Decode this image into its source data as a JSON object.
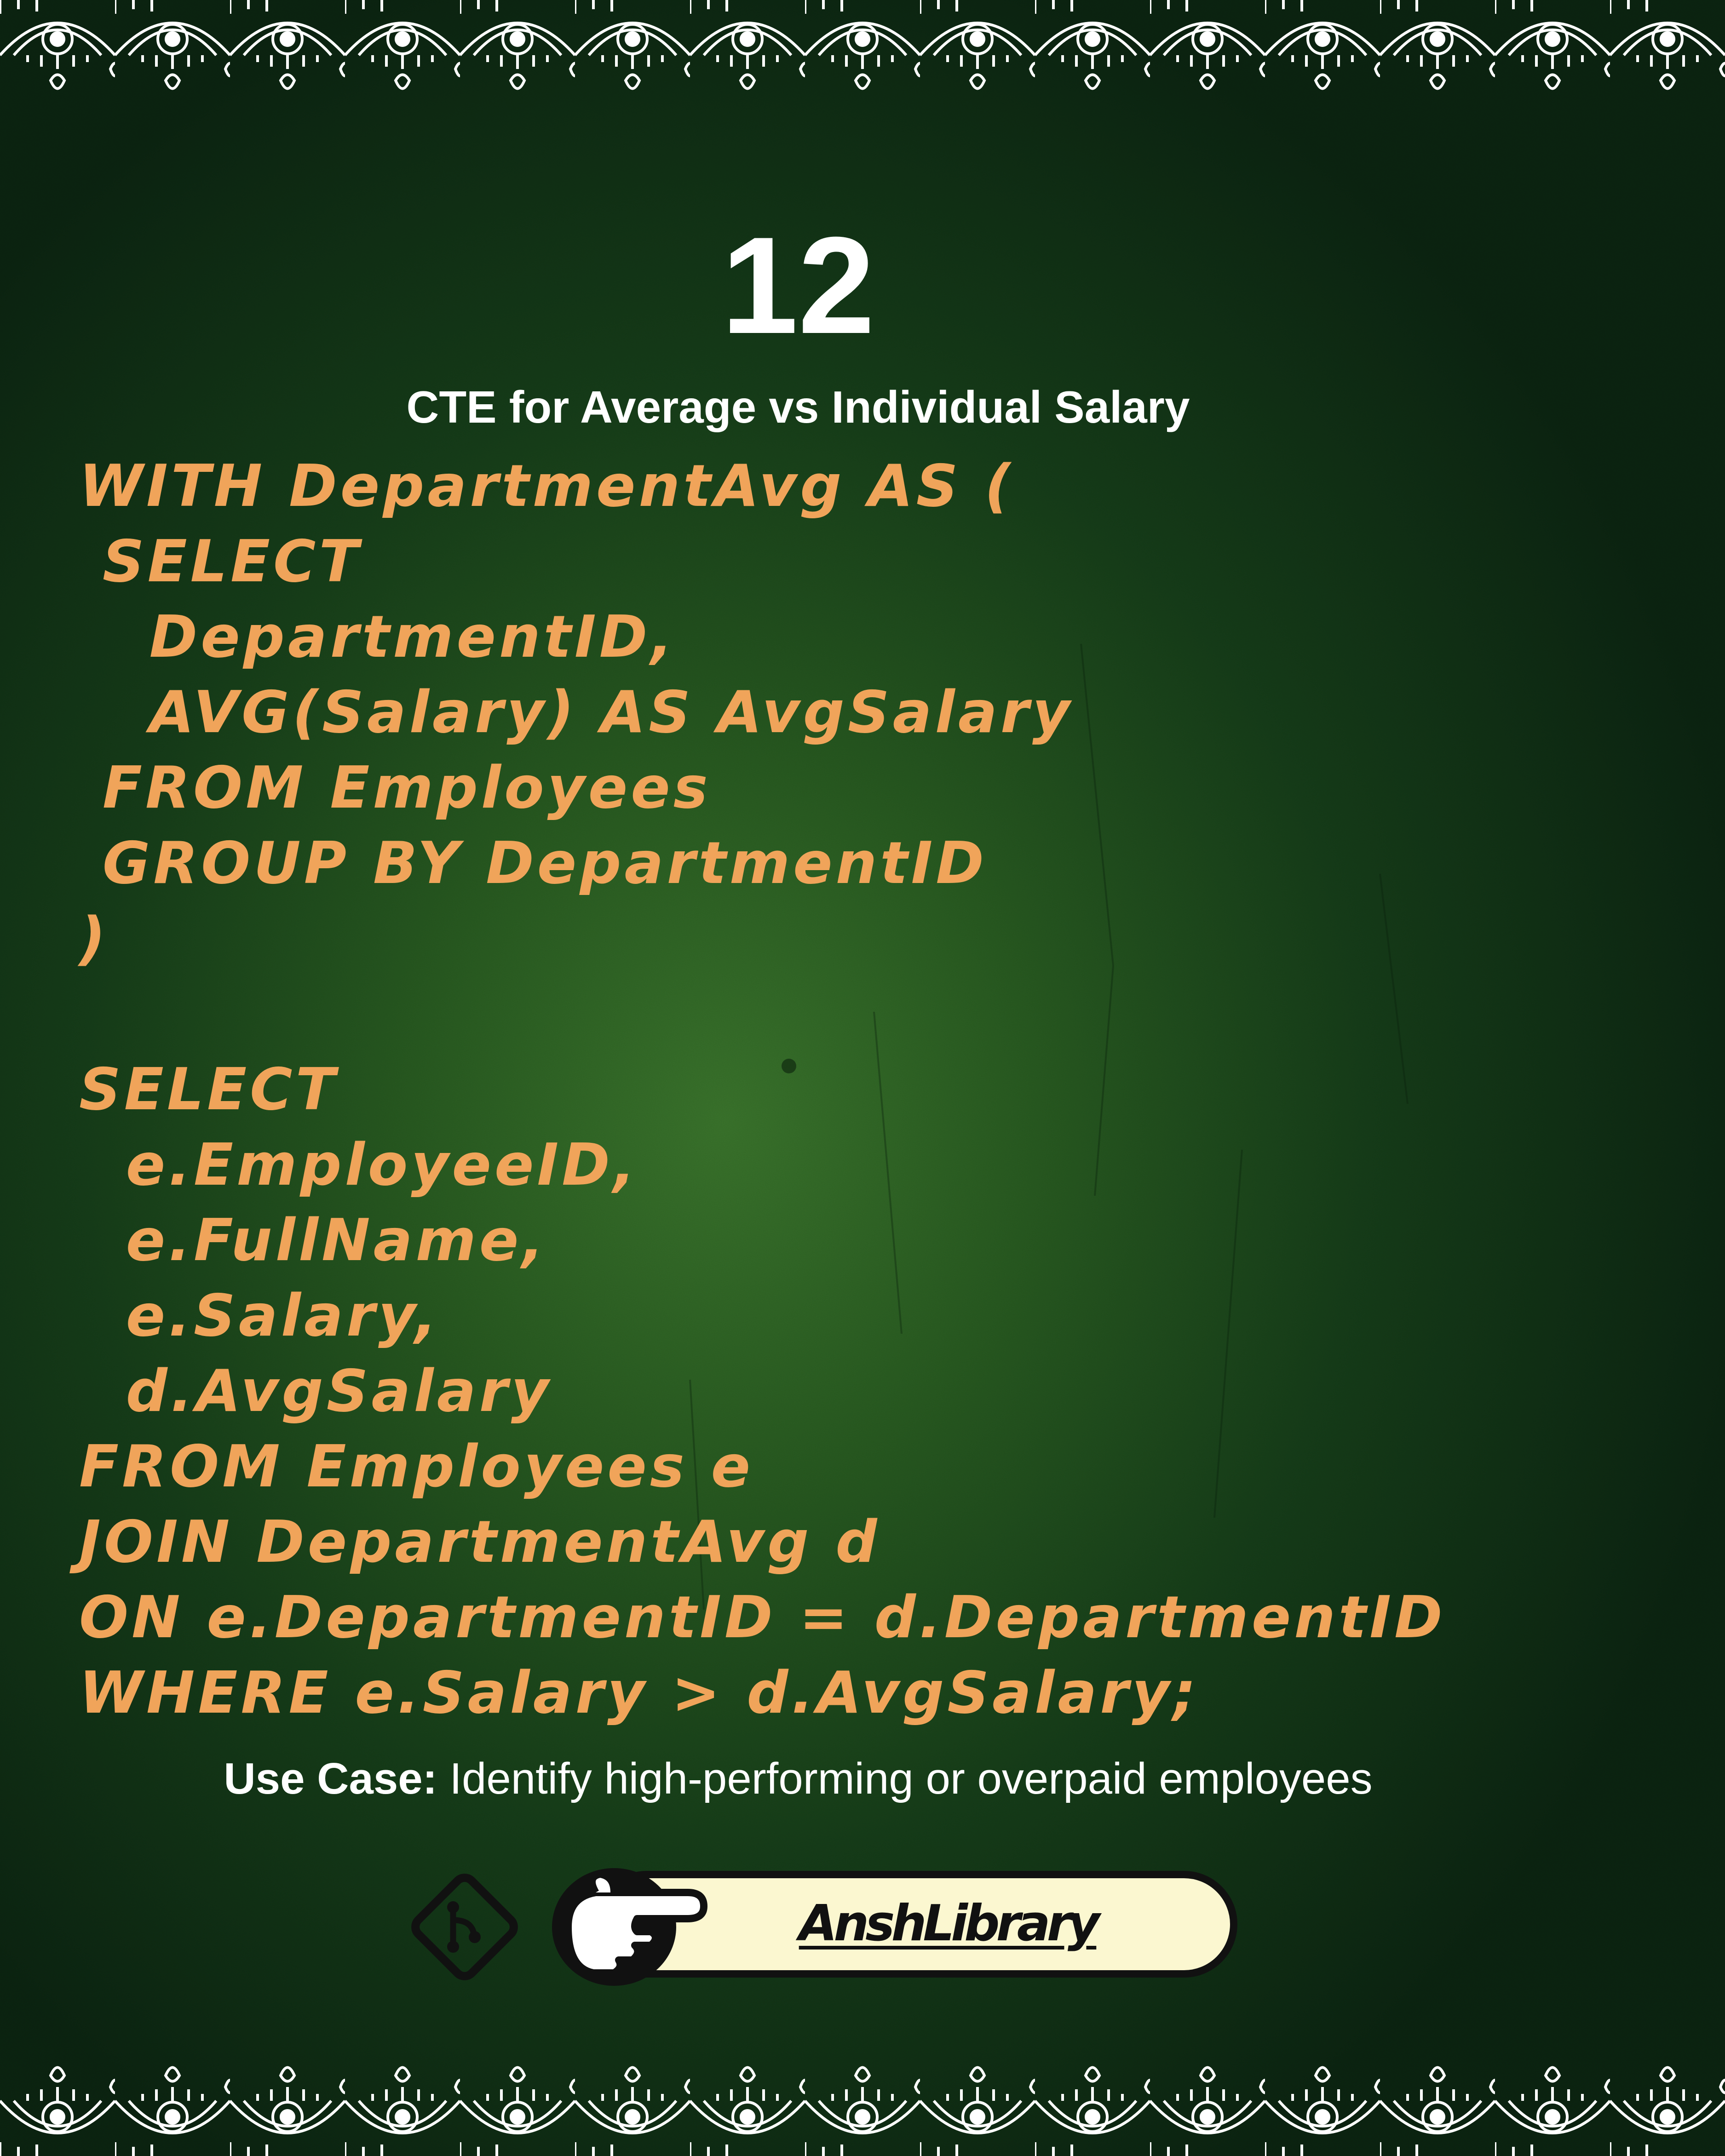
{
  "slide": {
    "number": "12",
    "title": "CTE for Average vs Individual Salary"
  },
  "code": {
    "lines": [
      "WITH DepartmentAvg AS (",
      " SELECT",
      "   DepartmentID,",
      "   AVG(Salary) AS AvgSalary",
      " FROM Employees",
      " GROUP BY DepartmentID",
      ")",
      "",
      "SELECT",
      "  e.EmployeeID,",
      "  e.FullName,",
      "  e.Salary,",
      "  d.AvgSalary",
      "FROM Employees e",
      "JOIN DepartmentAvg d",
      "ON e.DepartmentID = d.DepartmentID",
      "WHERE e.Salary > d.AvgSalary;"
    ]
  },
  "use_case": {
    "label": "Use Case:",
    "text": " Identify high-performing or overpaid employees"
  },
  "brand": {
    "name": "AnshLibrary",
    "icons": [
      "git-branch-icon",
      "pointing-hand-icon"
    ]
  },
  "colors": {
    "code": "#f0a45a",
    "text": "#ffffff",
    "background": "#1e4d1e",
    "brand_pill": "#fbf7d0"
  }
}
